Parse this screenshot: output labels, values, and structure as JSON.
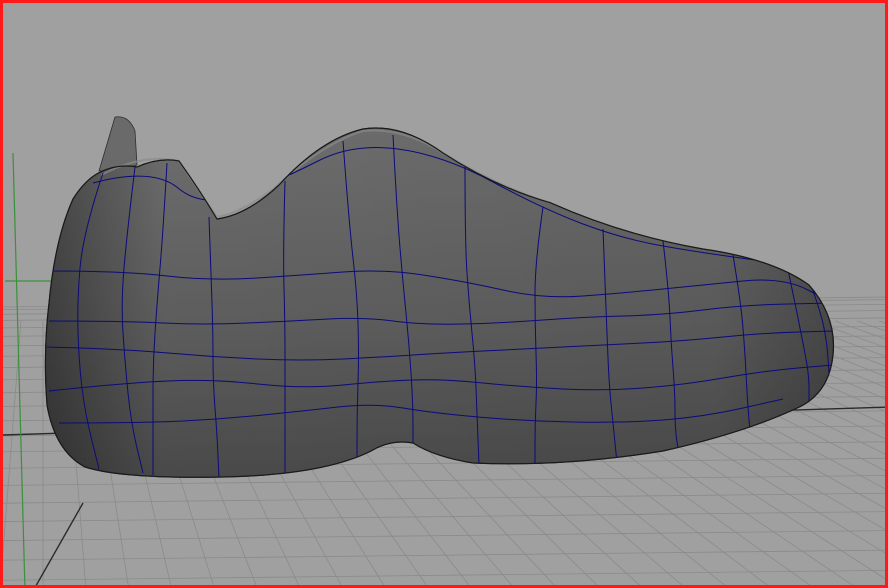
{
  "app": {
    "name": "3D viewport"
  },
  "viewport": {
    "active_border_color": "#ff1a1a",
    "background_color": "#a0a0a0",
    "grid_color": "#8a8a8a",
    "grid_major_color": "#2a2a2a",
    "y_axis_color": "#3c8f3c"
  },
  "model": {
    "kind": "polygon-mesh-shoe",
    "surface_color": "#5f5f5f",
    "wire_color": "#0b0b7a",
    "display_mode": "smooth-shaded-with-wireframe"
  }
}
